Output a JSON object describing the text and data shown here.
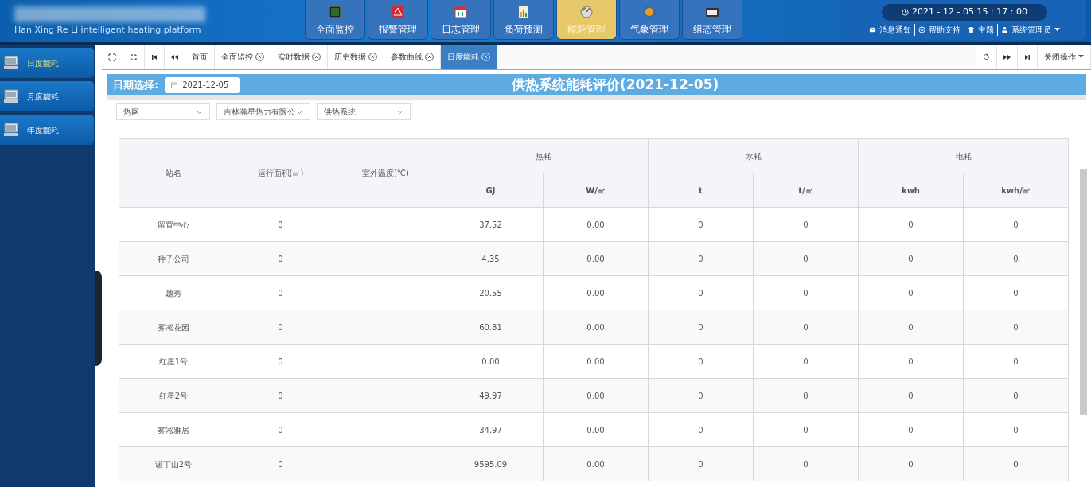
{
  "header": {
    "subtitle": "Han Xing Re Li intelligent heating platform",
    "datetime": "2021 - 12 - 05   15 : 17 : 00",
    "links": [
      {
        "kind": "mail",
        "label": "消息通知"
      },
      {
        "kind": "help",
        "label": "帮助支持"
      },
      {
        "kind": "theme",
        "label": "主题"
      },
      {
        "kind": "user",
        "label": "系统管理员"
      }
    ]
  },
  "nav": [
    {
      "label": "全面监控",
      "selected": false
    },
    {
      "label": "报警管理",
      "selected": false
    },
    {
      "label": "日志管理",
      "selected": false
    },
    {
      "label": "负荷预测",
      "selected": false
    },
    {
      "label": "能耗管理",
      "selected": true
    },
    {
      "label": "气象管理",
      "selected": false
    },
    {
      "label": "组态管理",
      "selected": false
    }
  ],
  "sidebar": {
    "items": [
      {
        "label": "日度能耗",
        "selected": true
      },
      {
        "label": "月度能耗",
        "selected": false
      },
      {
        "label": "年度能耗",
        "selected": false
      }
    ]
  },
  "tabs": [
    {
      "label": "首页",
      "closable": false,
      "selected": false
    },
    {
      "label": "全面监控",
      "closable": true,
      "selected": false
    },
    {
      "label": "实时数据",
      "closable": true,
      "selected": false
    },
    {
      "label": "历史数据",
      "closable": true,
      "selected": false
    },
    {
      "label": "参数曲线",
      "closable": true,
      "selected": false
    },
    {
      "label": "日度能耗",
      "closable": true,
      "selected": true
    }
  ],
  "close_menu": "关闭操作",
  "date_label": "日期选择:",
  "date_value": "2021-12-05",
  "report_title": "供热系统能耗评价(2021-12-05)",
  "filters": [
    "热网",
    "吉林瀚星热力有限公",
    "供热系统"
  ],
  "table": {
    "fixed_columns": [
      "站名",
      "运行面积(㎡)",
      "室外温度(℃)"
    ],
    "groups": [
      {
        "label": "热耗",
        "columns": [
          "GJ",
          "W/㎡"
        ]
      },
      {
        "label": "水耗",
        "columns": [
          "t",
          "t/㎡"
        ]
      },
      {
        "label": "电耗",
        "columns": [
          "kwh",
          "kwh/㎡"
        ]
      }
    ],
    "rows": [
      [
        "留置中心",
        "0",
        "",
        "37.52",
        "0.00",
        "0",
        "0",
        "0",
        "0"
      ],
      [
        "种子公司",
        "0",
        "",
        "4.35",
        "0.00",
        "0",
        "0",
        "0",
        "0"
      ],
      [
        "越秀",
        "0",
        "",
        "20.55",
        "0.00",
        "0",
        "0",
        "0",
        "0"
      ],
      [
        "雾凇花园",
        "0",
        "",
        "60.81",
        "0.00",
        "0",
        "0",
        "0",
        "0"
      ],
      [
        "红星1号",
        "0",
        "",
        "0.00",
        "0.00",
        "0",
        "0",
        "0",
        "0"
      ],
      [
        "红星2号",
        "0",
        "",
        "49.97",
        "0.00",
        "0",
        "0",
        "0",
        "0"
      ],
      [
        "雾凇雅居",
        "0",
        "",
        "34.97",
        "0.00",
        "0",
        "0",
        "0",
        "0"
      ],
      [
        "诺丁山2号",
        "0",
        "",
        "9595.09",
        "0.00",
        "0",
        "0",
        "0",
        "0"
      ]
    ]
  }
}
